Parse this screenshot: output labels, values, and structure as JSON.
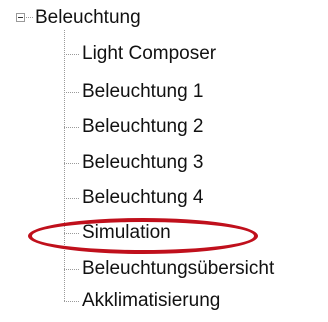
{
  "tree": {
    "root": {
      "label": "Beleuchtung",
      "expanded": true,
      "expander_icon": "minus-box-icon"
    },
    "children": [
      {
        "label": "Light Composer"
      },
      {
        "label": "Beleuchtung 1"
      },
      {
        "label": "Beleuchtung 2"
      },
      {
        "label": "Beleuchtung 3"
      },
      {
        "label": "Beleuchtung 4"
      },
      {
        "label": "Simulation",
        "highlighted": true
      },
      {
        "label": "Beleuchtungsübersicht"
      },
      {
        "label": "Akklimatisierung"
      }
    ]
  },
  "annotation": {
    "highlight_color": "#c0101c",
    "highlight_target": "Simulation"
  }
}
